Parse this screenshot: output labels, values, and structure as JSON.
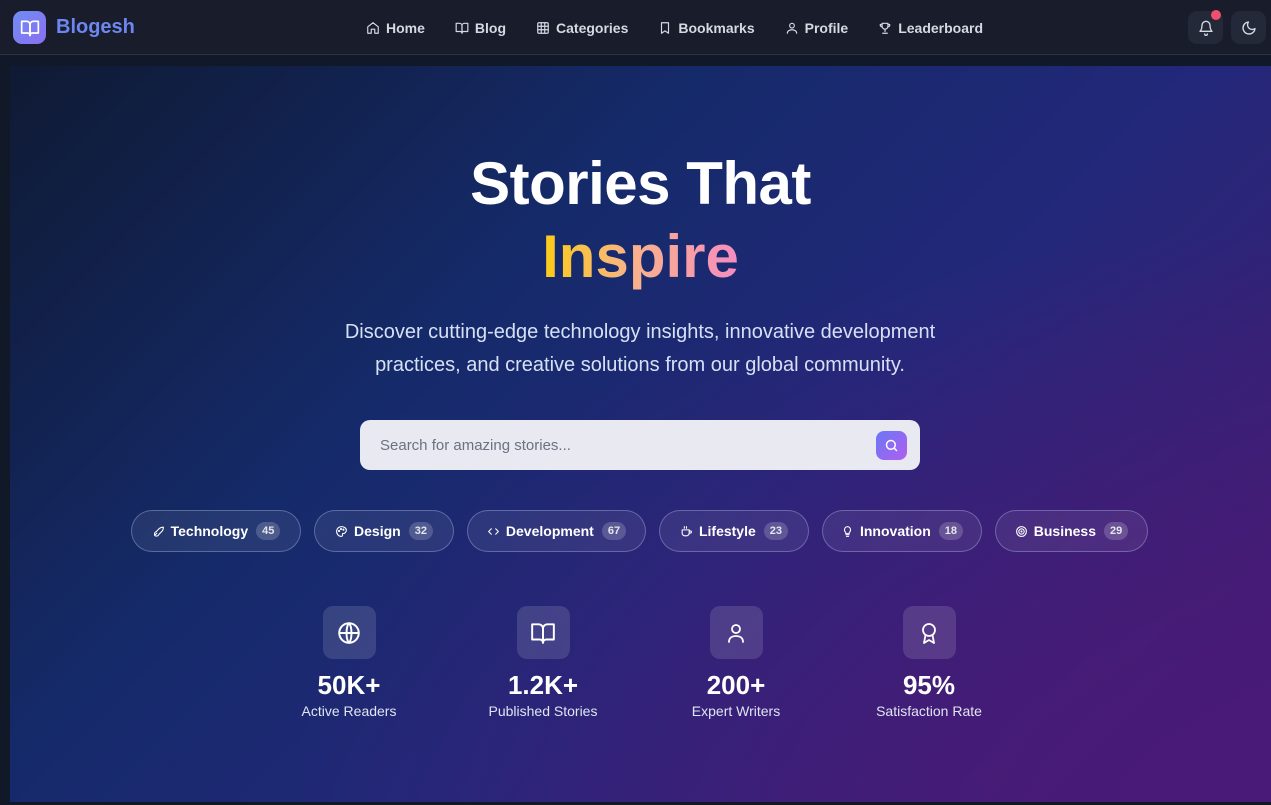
{
  "brand": {
    "name": "Blogesh",
    "icon": "book-open-icon"
  },
  "nav": {
    "items": [
      {
        "label": "Home",
        "icon": "home-icon"
      },
      {
        "label": "Blog",
        "icon": "book-icon"
      },
      {
        "label": "Categories",
        "icon": "grid-icon"
      },
      {
        "label": "Bookmarks",
        "icon": "bookmark-icon"
      },
      {
        "label": "Profile",
        "icon": "user-icon"
      },
      {
        "label": "Leaderboard",
        "icon": "trophy-icon"
      }
    ],
    "notification_icon": "bell-icon",
    "theme_icon": "moon-icon"
  },
  "hero": {
    "title": "Stories That",
    "highlight": "Inspire",
    "subtitle": "Discover cutting-edge technology insights, innovative development practices, and creative solutions from our global community.",
    "search": {
      "placeholder": "Search for amazing stories...",
      "value": ""
    }
  },
  "categories": [
    {
      "label": "Technology",
      "count": "45",
      "icon": "rocket-icon"
    },
    {
      "label": "Design",
      "count": "32",
      "icon": "palette-icon"
    },
    {
      "label": "Development",
      "count": "67",
      "icon": "code-icon"
    },
    {
      "label": "Lifestyle",
      "count": "23",
      "icon": "coffee-icon"
    },
    {
      "label": "Innovation",
      "count": "18",
      "icon": "lightbulb-icon"
    },
    {
      "label": "Business",
      "count": "29",
      "icon": "target-icon"
    }
  ],
  "stats": [
    {
      "value": "50K+",
      "label": "Active Readers",
      "icon": "globe-icon"
    },
    {
      "value": "1.2K+",
      "label": "Published Stories",
      "icon": "book-open-icon"
    },
    {
      "value": "200+",
      "label": "Expert Writers",
      "icon": "user-icon"
    },
    {
      "value": "95%",
      "label": "Satisfaction Rate",
      "icon": "award-icon"
    }
  ],
  "colors": {
    "accent": "#6d86f0",
    "highlight_start": "#facc15",
    "highlight_end": "#f58cc0",
    "notification": "#f0506e"
  }
}
